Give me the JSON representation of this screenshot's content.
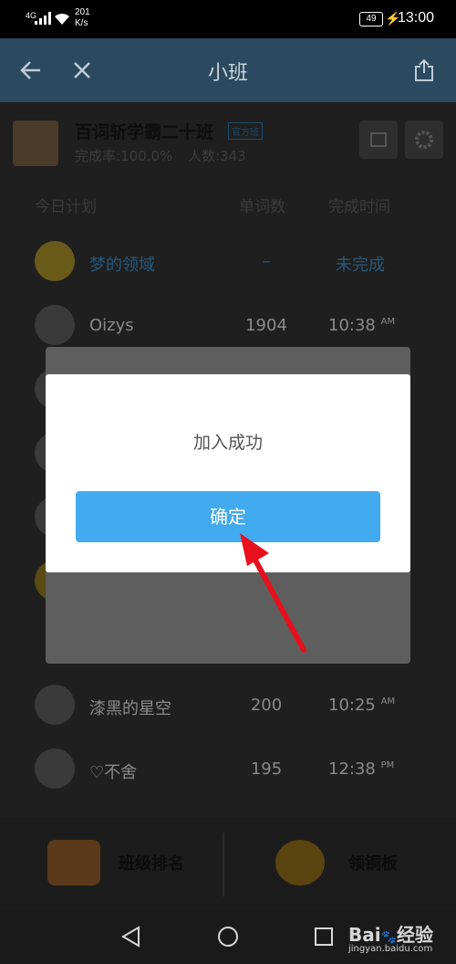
{
  "status_bar": {
    "network": "4G",
    "speed_value": "201",
    "speed_unit": "K/s",
    "battery": "49",
    "time": "13:00"
  },
  "header": {
    "title": "小班"
  },
  "group": {
    "name": "百词斩学霸二十班",
    "badge": "官方班",
    "completion": "完成率:100.0%",
    "members": "人数:343"
  },
  "plan": {
    "headers": [
      "今日计划",
      "单词数",
      "完成时间"
    ],
    "rows": [
      {
        "name": "梦的领域",
        "count": "–",
        "time": "未完成",
        "ampm": ""
      },
      {
        "name": "Oizys",
        "count": "1904",
        "time": "10:38",
        "ampm": "AM"
      },
      {
        "name": "漆黑的星空",
        "count": "200",
        "time": "10:25",
        "ampm": "AM"
      },
      {
        "name": "♡不舍",
        "count": "195",
        "time": "12:38",
        "ampm": "PM"
      }
    ]
  },
  "bottom_tabs": {
    "ranking": "班级排名",
    "copper": "领铜板"
  },
  "dialog": {
    "message": "加入成功",
    "confirm": "确定"
  },
  "watermark": {
    "brand": "Bai",
    "brand2": "经验",
    "url": "jingyan.baidu.com"
  }
}
